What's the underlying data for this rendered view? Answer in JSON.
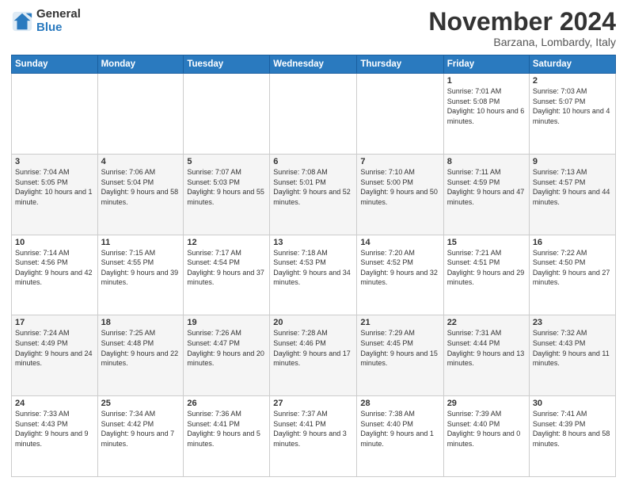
{
  "logo": {
    "general": "General",
    "blue": "Blue"
  },
  "title": "November 2024",
  "location": "Barzana, Lombardy, Italy",
  "headers": [
    "Sunday",
    "Monday",
    "Tuesday",
    "Wednesday",
    "Thursday",
    "Friday",
    "Saturday"
  ],
  "rows": [
    [
      {
        "day": "",
        "info": ""
      },
      {
        "day": "",
        "info": ""
      },
      {
        "day": "",
        "info": ""
      },
      {
        "day": "",
        "info": ""
      },
      {
        "day": "",
        "info": ""
      },
      {
        "day": "1",
        "info": "Sunrise: 7:01 AM\nSunset: 5:08 PM\nDaylight: 10 hours and 6 minutes."
      },
      {
        "day": "2",
        "info": "Sunrise: 7:03 AM\nSunset: 5:07 PM\nDaylight: 10 hours and 4 minutes."
      }
    ],
    [
      {
        "day": "3",
        "info": "Sunrise: 7:04 AM\nSunset: 5:05 PM\nDaylight: 10 hours and 1 minute."
      },
      {
        "day": "4",
        "info": "Sunrise: 7:06 AM\nSunset: 5:04 PM\nDaylight: 9 hours and 58 minutes."
      },
      {
        "day": "5",
        "info": "Sunrise: 7:07 AM\nSunset: 5:03 PM\nDaylight: 9 hours and 55 minutes."
      },
      {
        "day": "6",
        "info": "Sunrise: 7:08 AM\nSunset: 5:01 PM\nDaylight: 9 hours and 52 minutes."
      },
      {
        "day": "7",
        "info": "Sunrise: 7:10 AM\nSunset: 5:00 PM\nDaylight: 9 hours and 50 minutes."
      },
      {
        "day": "8",
        "info": "Sunrise: 7:11 AM\nSunset: 4:59 PM\nDaylight: 9 hours and 47 minutes."
      },
      {
        "day": "9",
        "info": "Sunrise: 7:13 AM\nSunset: 4:57 PM\nDaylight: 9 hours and 44 minutes."
      }
    ],
    [
      {
        "day": "10",
        "info": "Sunrise: 7:14 AM\nSunset: 4:56 PM\nDaylight: 9 hours and 42 minutes."
      },
      {
        "day": "11",
        "info": "Sunrise: 7:15 AM\nSunset: 4:55 PM\nDaylight: 9 hours and 39 minutes."
      },
      {
        "day": "12",
        "info": "Sunrise: 7:17 AM\nSunset: 4:54 PM\nDaylight: 9 hours and 37 minutes."
      },
      {
        "day": "13",
        "info": "Sunrise: 7:18 AM\nSunset: 4:53 PM\nDaylight: 9 hours and 34 minutes."
      },
      {
        "day": "14",
        "info": "Sunrise: 7:20 AM\nSunset: 4:52 PM\nDaylight: 9 hours and 32 minutes."
      },
      {
        "day": "15",
        "info": "Sunrise: 7:21 AM\nSunset: 4:51 PM\nDaylight: 9 hours and 29 minutes."
      },
      {
        "day": "16",
        "info": "Sunrise: 7:22 AM\nSunset: 4:50 PM\nDaylight: 9 hours and 27 minutes."
      }
    ],
    [
      {
        "day": "17",
        "info": "Sunrise: 7:24 AM\nSunset: 4:49 PM\nDaylight: 9 hours and 24 minutes."
      },
      {
        "day": "18",
        "info": "Sunrise: 7:25 AM\nSunset: 4:48 PM\nDaylight: 9 hours and 22 minutes."
      },
      {
        "day": "19",
        "info": "Sunrise: 7:26 AM\nSunset: 4:47 PM\nDaylight: 9 hours and 20 minutes."
      },
      {
        "day": "20",
        "info": "Sunrise: 7:28 AM\nSunset: 4:46 PM\nDaylight: 9 hours and 17 minutes."
      },
      {
        "day": "21",
        "info": "Sunrise: 7:29 AM\nSunset: 4:45 PM\nDaylight: 9 hours and 15 minutes."
      },
      {
        "day": "22",
        "info": "Sunrise: 7:31 AM\nSunset: 4:44 PM\nDaylight: 9 hours and 13 minutes."
      },
      {
        "day": "23",
        "info": "Sunrise: 7:32 AM\nSunset: 4:43 PM\nDaylight: 9 hours and 11 minutes."
      }
    ],
    [
      {
        "day": "24",
        "info": "Sunrise: 7:33 AM\nSunset: 4:43 PM\nDaylight: 9 hours and 9 minutes."
      },
      {
        "day": "25",
        "info": "Sunrise: 7:34 AM\nSunset: 4:42 PM\nDaylight: 9 hours and 7 minutes."
      },
      {
        "day": "26",
        "info": "Sunrise: 7:36 AM\nSunset: 4:41 PM\nDaylight: 9 hours and 5 minutes."
      },
      {
        "day": "27",
        "info": "Sunrise: 7:37 AM\nSunset: 4:41 PM\nDaylight: 9 hours and 3 minutes."
      },
      {
        "day": "28",
        "info": "Sunrise: 7:38 AM\nSunset: 4:40 PM\nDaylight: 9 hours and 1 minute."
      },
      {
        "day": "29",
        "info": "Sunrise: 7:39 AM\nSunset: 4:40 PM\nDaylight: 9 hours and 0 minutes."
      },
      {
        "day": "30",
        "info": "Sunrise: 7:41 AM\nSunset: 4:39 PM\nDaylight: 8 hours and 58 minutes."
      }
    ]
  ]
}
